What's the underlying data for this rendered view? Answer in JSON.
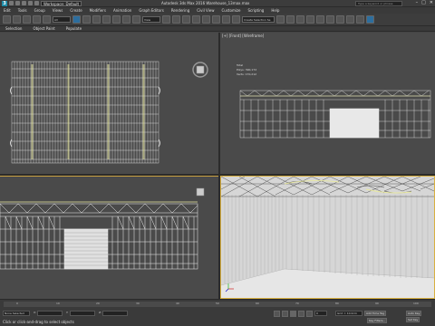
{
  "app": {
    "logo_letter": "3",
    "workspace": "Workspace: Default",
    "title": "Autodesk 3ds Max 2016    Warehouse_13max.max",
    "search_placeholder": "Type a keyword or phrase",
    "win_min": "–",
    "win_max": "□",
    "win_close": "✕"
  },
  "menu": [
    "Edit",
    "Tools",
    "Group",
    "Views",
    "Create",
    "Modifiers",
    "Animation",
    "Graph Editors",
    "Rendering",
    "Civil View",
    "Customize",
    "Scripting",
    "Help"
  ],
  "toolbar": {
    "filter": "All",
    "view": "View",
    "selection_set": "Create Selection Se"
  },
  "ribbon": [
    "Selection",
    "Object Paint",
    "Populate"
  ],
  "viewports": {
    "front_label": "[+] [Front] [Wireframe]",
    "stats": {
      "total": "Total",
      "polys_label": "Polys:",
      "polys": "390,172",
      "verts_label": "Verts:",
      "verts": "170,212"
    }
  },
  "timeline": {
    "ticks": [
      "0",
      "10",
      "20",
      "30",
      "40",
      "50",
      "60",
      "70",
      "80",
      "90",
      "100"
    ]
  },
  "status": {
    "selected": "None Selected",
    "hint": "Click or click-and-drag to select objects",
    "x": "X:",
    "y": "Y:",
    "z": "Z:",
    "grid": "Grid = 10.0cm",
    "add_time_tag": "Add Time Tag",
    "auto_key": "Auto Key",
    "set_key": "Set Key",
    "key_filters": "Key Filters...",
    "frame": "0"
  },
  "colors": {
    "viewport_bg": "#4a4a4a",
    "active_border": "#d8b040",
    "wire": "#f0f0f0",
    "highlight": "#e8e8a0"
  }
}
